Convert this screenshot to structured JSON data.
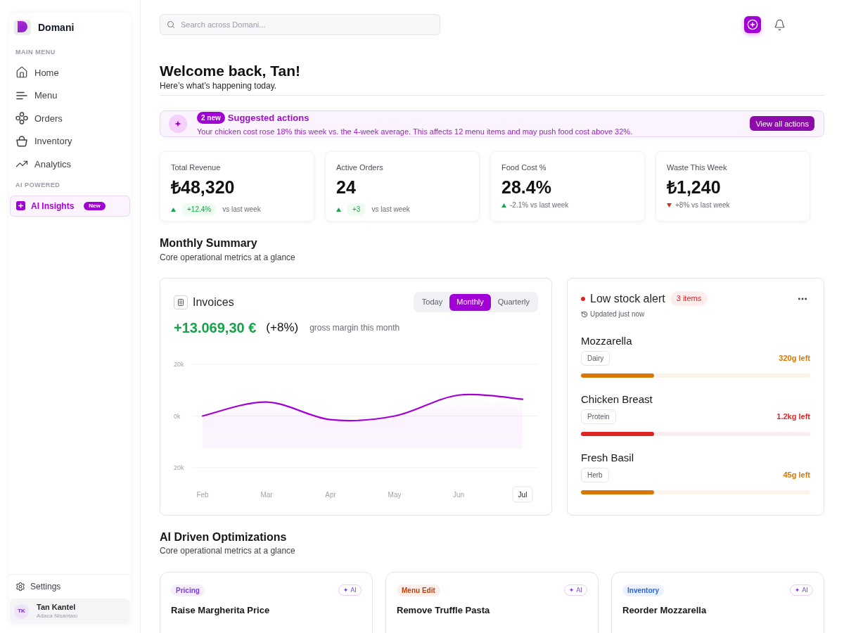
{
  "sidebar": {
    "brand": "Domani",
    "sections": [
      {
        "heading": "MAIN MENU",
        "items": [
          {
            "label": "Home",
            "selected": false
          },
          {
            "label": "Menu",
            "selected": false
          },
          {
            "label": "Orders",
            "selected": false
          },
          {
            "label": "Inventory",
            "selected": false
          },
          {
            "label": "Analytics",
            "selected": false
          }
        ]
      },
      {
        "heading": "AI POWERED",
        "items": [
          {
            "label": "AI Insights",
            "badge": "New",
            "selected": true
          }
        ]
      }
    ],
    "footer": {
      "settings": "Settings",
      "user": {
        "initials": "TK",
        "name": "Tan Kantel",
        "subtitle": "Adaca Nisantası"
      }
    }
  },
  "header": {
    "search": {
      "placeholder": "Search across Domani..."
    }
  },
  "welcome": {
    "title": "Welcome back, Tan!",
    "subtitle": "Here’s what’s happening today."
  },
  "suggestions": {
    "badge": "2 new",
    "title": "Suggested actions",
    "message": "Your chicken cost rose 18% this week vs. the 4-week average. This affects 12 menu items and may push food cost above 32%.",
    "button": "View all actions"
  },
  "stats": [
    {
      "label": "Total Revenue",
      "value": "₺48,320",
      "rising": true,
      "kind": "pill",
      "change": "+12.4%",
      "note": "vs last week"
    },
    {
      "label": "Active Orders",
      "value": "24",
      "rising": true,
      "kind": "pill",
      "change": "+3",
      "note": "vs last week"
    },
    {
      "label": "Food Cost %",
      "value": "28.4%",
      "rising": true,
      "kind": "inline",
      "change": "-2.1% vs last week"
    },
    {
      "label": "Waste This Week",
      "value": "₺1,240",
      "rising": false,
      "kind": "inline",
      "change": "+8% vs last week"
    }
  ],
  "monthly_summary": {
    "title": "Monthly Summary",
    "subtitle": "Core operational metrics at a glance"
  },
  "invoices": {
    "title": "Invoices",
    "periods": [
      {
        "label": "Today",
        "selected": false
      },
      {
        "label": "Monthly",
        "selected": true
      },
      {
        "label": "Quarterly",
        "selected": false
      }
    ],
    "amount": "+13.069,30 €",
    "change": "(+8%)",
    "caption": "gross margin this month",
    "months": [
      {
        "selected": false
      },
      {
        "selected": false
      },
      {
        "selected": false
      },
      {
        "selected": false
      },
      {
        "selected": false
      },
      {
        "selected": true
      }
    ],
    "chart_data": {
      "type": "line",
      "categories": [
        "Feb",
        "Mar",
        "Apr",
        "May",
        "Jun",
        "Jul"
      ],
      "series": [
        {
          "color": "#a100d6",
          "values": [
            0,
            5400,
            -1400,
            0,
            8100,
            6500
          ]
        }
      ],
      "ylim": [
        -20000,
        20000
      ],
      "yticks": [
        {
          "value": 20000,
          "label": "20k"
        },
        {
          "value": 0,
          "label": "0k"
        },
        {
          "value": -20000,
          "label": "20k"
        }
      ]
    }
  },
  "low_stock": {
    "title": "Low stock alert",
    "badge": "3 items",
    "updated": "Updated just now",
    "items": [
      {
        "name": "Mozzarella",
        "tag": "Dairy",
        "amount": "320g left",
        "color": "#d97706",
        "level": 0.32
      },
      {
        "name": "Chicken Breast",
        "tag": "Protein",
        "amount": "1.2kg left",
        "color": "#dc2626",
        "level": 0.32
      },
      {
        "name": "Fresh Basil",
        "tag": "Herb",
        "amount": "45g left",
        "color": "#d97706",
        "level": 0.32
      }
    ]
  },
  "optimizations": {
    "title": "AI Driven Optimizations",
    "subtitle": "Core operational metrics at a glance",
    "cards": [
      {
        "tag": "Pricing",
        "color": "#7c3aed",
        "ai_badge": "✦ AI",
        "title": "Raise Margherita Price"
      },
      {
        "tag": "Menu Edit",
        "color": "#c2410c",
        "ai_badge": "✦ AI",
        "title": "Remove Truffle Pasta"
      },
      {
        "tag": "Inventory",
        "color": "#2563eb",
        "ai_badge": "✦ AI",
        "title": "Reorder Mozzarella"
      }
    ]
  }
}
